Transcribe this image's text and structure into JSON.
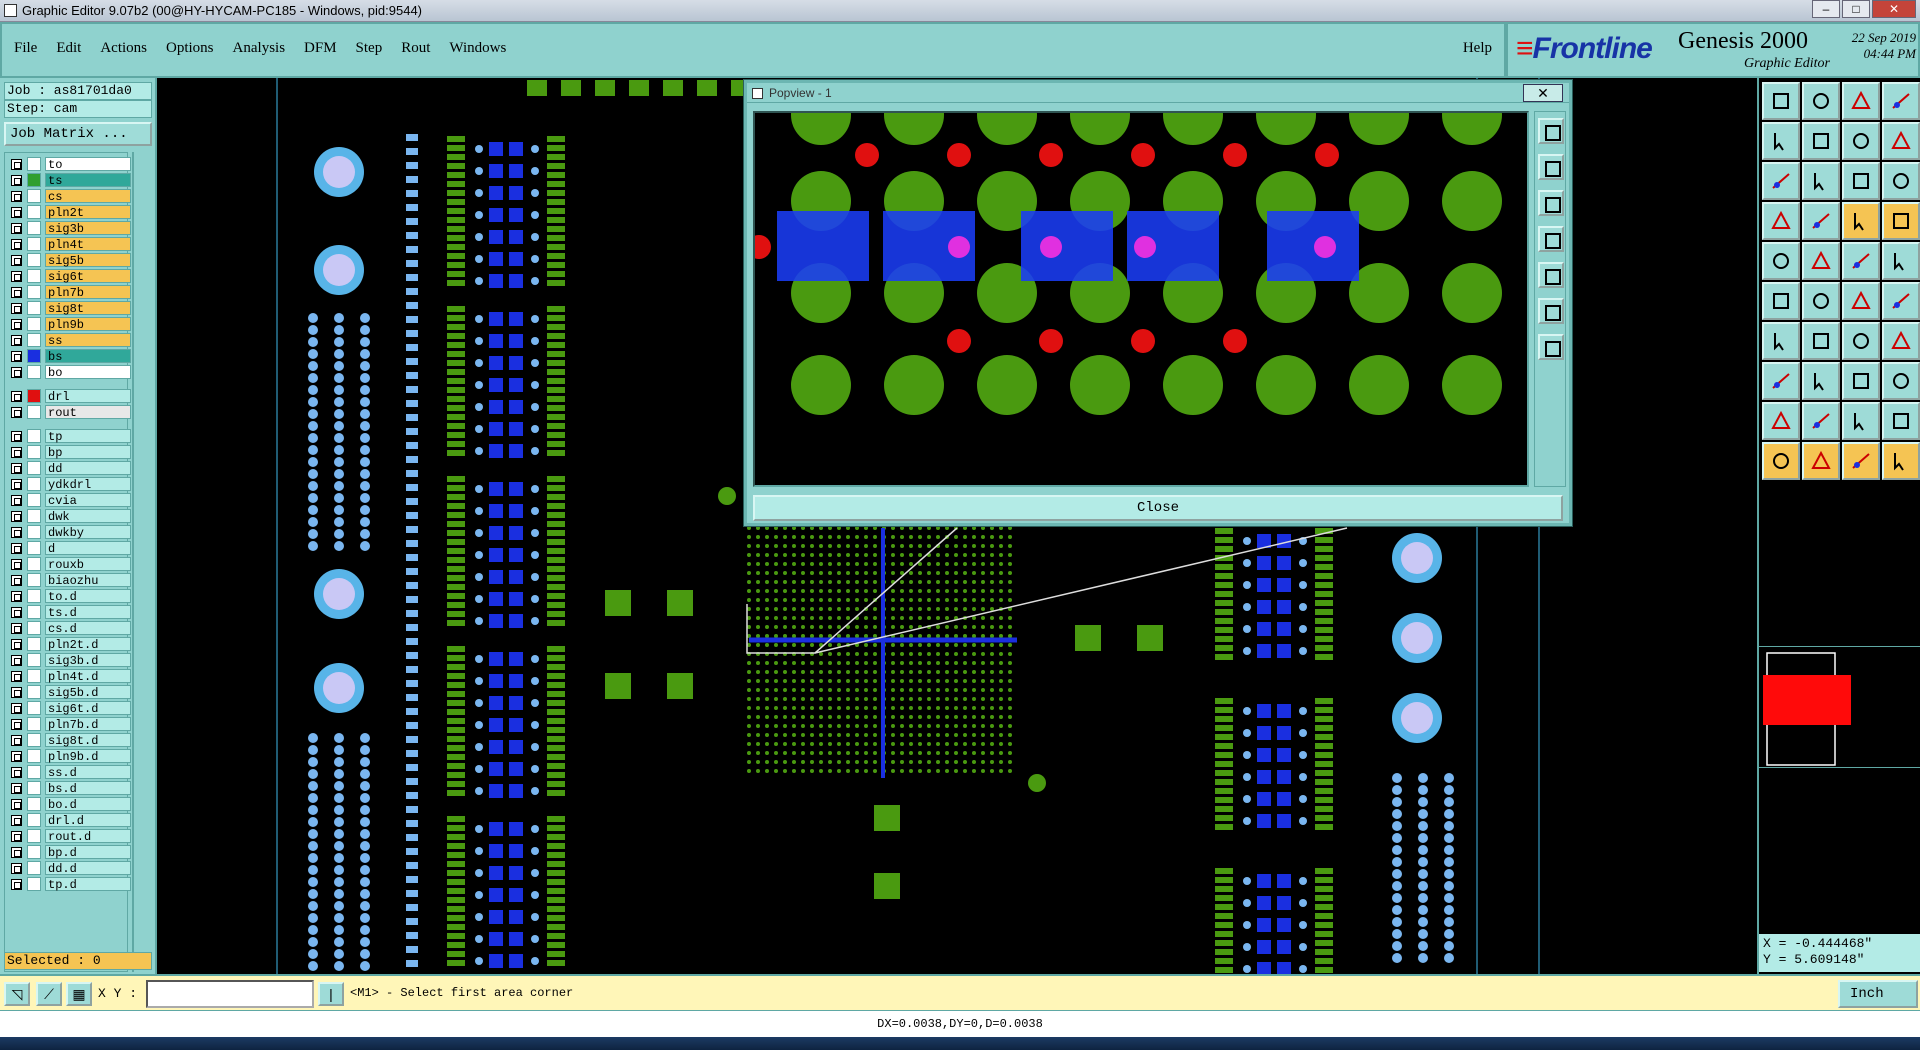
{
  "window": {
    "title": "Graphic Editor 9.07b2 (00@HY-HYCAM-PC185 - Windows, pid:9544)"
  },
  "menu": {
    "items": [
      "File",
      "Edit",
      "Actions",
      "Options",
      "Analysis",
      "DFM",
      "Step",
      "Rout",
      "Windows"
    ],
    "help": "Help"
  },
  "brand": {
    "logo": "Frontline",
    "product": "Genesis 2000",
    "subtitle": "Graphic Editor",
    "date": "22 Sep 2019",
    "time": "04:44 PM"
  },
  "job": {
    "job_line": "Job : as81701da0",
    "step_line": "Step: cam",
    "matrix_button": "Job Matrix ..."
  },
  "layers": [
    {
      "name": "to",
      "color": "#ffffff",
      "swatch": "#ffffff"
    },
    {
      "name": "ts",
      "color": "#30a89a",
      "swatch": "#2f9f2f"
    },
    {
      "name": "cs",
      "color": "#f5c453",
      "swatch": "#ffffff"
    },
    {
      "name": "pln2t",
      "color": "#f5c453",
      "swatch": "#ffffff"
    },
    {
      "name": "sig3b",
      "color": "#f5c453",
      "swatch": "#ffffff"
    },
    {
      "name": "pln4t",
      "color": "#f5c453",
      "swatch": "#ffffff"
    },
    {
      "name": "sig5b",
      "color": "#f5c453",
      "swatch": "#ffffff"
    },
    {
      "name": "sig6t",
      "color": "#f5c453",
      "swatch": "#ffffff"
    },
    {
      "name": "pln7b",
      "color": "#f5c453",
      "swatch": "#ffffff"
    },
    {
      "name": "sig8t",
      "color": "#f5c453",
      "swatch": "#ffffff"
    },
    {
      "name": "pln9b",
      "color": "#f5c453",
      "swatch": "#ffffff"
    },
    {
      "name": "ss",
      "color": "#f5c453",
      "swatch": "#ffffff"
    },
    {
      "name": "bs",
      "color": "#30a89a",
      "swatch": "#1a2fe0"
    },
    {
      "name": "bo",
      "color": "#ffffff",
      "swatch": "#ffffff"
    },
    {
      "name": "drl",
      "color": "#b3ebe6",
      "swatch": "#e01010"
    },
    {
      "name": "rout",
      "color": "#e8e8e8",
      "swatch": "#ffffff"
    },
    {
      "name": "tp",
      "color": "#b3ebe6",
      "swatch": "#ffffff"
    },
    {
      "name": "bp",
      "color": "#b3ebe6",
      "swatch": "#ffffff"
    },
    {
      "name": "dd",
      "color": "#b3ebe6",
      "swatch": "#ffffff"
    },
    {
      "name": "ydkdrl",
      "color": "#b3ebe6",
      "swatch": "#ffffff"
    },
    {
      "name": "cvia",
      "color": "#b3ebe6",
      "swatch": "#ffffff"
    },
    {
      "name": "dwk",
      "color": "#b3ebe6",
      "swatch": "#ffffff"
    },
    {
      "name": "dwkby",
      "color": "#b3ebe6",
      "swatch": "#ffffff"
    },
    {
      "name": "d",
      "color": "#b3ebe6",
      "swatch": "#ffffff"
    },
    {
      "name": "rouxb",
      "color": "#b3ebe6",
      "swatch": "#ffffff"
    },
    {
      "name": "biaozhu",
      "color": "#b3ebe6",
      "swatch": "#ffffff"
    },
    {
      "name": "to.d",
      "color": "#b3ebe6",
      "swatch": "#ffffff"
    },
    {
      "name": "ts.d",
      "color": "#b3ebe6",
      "swatch": "#ffffff"
    },
    {
      "name": "cs.d",
      "color": "#b3ebe6",
      "swatch": "#ffffff"
    },
    {
      "name": "pln2t.d",
      "color": "#b3ebe6",
      "swatch": "#ffffff"
    },
    {
      "name": "sig3b.d",
      "color": "#b3ebe6",
      "swatch": "#ffffff"
    },
    {
      "name": "pln4t.d",
      "color": "#b3ebe6",
      "swatch": "#ffffff"
    },
    {
      "name": "sig5b.d",
      "color": "#b3ebe6",
      "swatch": "#ffffff"
    },
    {
      "name": "sig6t.d",
      "color": "#b3ebe6",
      "swatch": "#ffffff"
    },
    {
      "name": "pln7b.d",
      "color": "#b3ebe6",
      "swatch": "#ffffff"
    },
    {
      "name": "sig8t.d",
      "color": "#b3ebe6",
      "swatch": "#ffffff"
    },
    {
      "name": "pln9b.d",
      "color": "#b3ebe6",
      "swatch": "#ffffff"
    },
    {
      "name": "ss.d",
      "color": "#b3ebe6",
      "swatch": "#ffffff"
    },
    {
      "name": "bs.d",
      "color": "#b3ebe6",
      "swatch": "#ffffff"
    },
    {
      "name": "bo.d",
      "color": "#b3ebe6",
      "swatch": "#ffffff"
    },
    {
      "name": "drl.d",
      "color": "#b3ebe6",
      "swatch": "#ffffff"
    },
    {
      "name": "rout.d",
      "color": "#b3ebe6",
      "swatch": "#ffffff"
    },
    {
      "name": "bp.d",
      "color": "#b3ebe6",
      "swatch": "#ffffff"
    },
    {
      "name": "dd.d",
      "color": "#b3ebe6",
      "swatch": "#ffffff"
    },
    {
      "name": "tp.d",
      "color": "#b3ebe6",
      "swatch": "#ffffff"
    }
  ],
  "selected": "Selected : 0",
  "popup": {
    "title": "Popview - 1",
    "close_x": "✕",
    "close_button": "Close"
  },
  "command": {
    "xy_label": "X Y :",
    "xy_value": "",
    "prompt": "<M1> - Select first area corner",
    "units": "Inch"
  },
  "coords": {
    "x": "X = -0.444468\"",
    "y": "Y = 5.609148\""
  },
  "status": "DX=0.0038,DY=0,D=0.0038",
  "colors": {
    "panel": "#8fd2ce",
    "pad_green": "#4a9a10",
    "pad_blue": "#1a2fe0",
    "via_lightblue": "#7ab6f0",
    "drill_red": "#e01010",
    "magenta": "#e030e0"
  }
}
